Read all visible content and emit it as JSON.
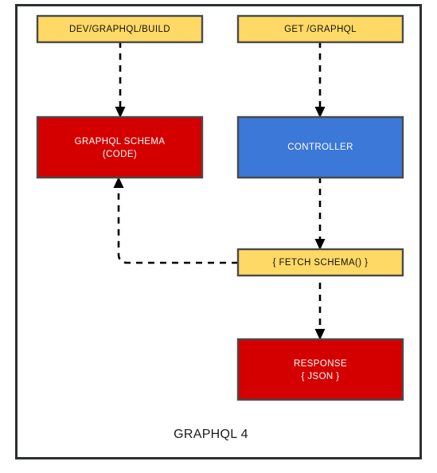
{
  "diagram": {
    "caption": "GRAPHQL 4",
    "frame": {
      "stroke_color": "#2d3033"
    },
    "colors": {
      "yellow_fill": "#FFD966",
      "red_fill": "#D40000",
      "blue_fill": "#3B78D8",
      "box_stroke": "#4a4a4a",
      "arrow_color": "#000000",
      "label_dark": "#111111",
      "label_light": "#ffffff"
    },
    "nodes": [
      {
        "id": "dev-graphql-build",
        "label": "DEV/GRAPHQL/BUILD",
        "fill": "#FFD966",
        "text_color": "dark"
      },
      {
        "id": "get-graphql",
        "label": "GET /GRAPHQL",
        "fill": "#FFD966",
        "text_color": "dark"
      },
      {
        "id": "graphql-schema",
        "label_line1": "GRAPHQL SCHEMA",
        "label_line2": "(CODE)",
        "fill": "#D40000",
        "text_color": "light"
      },
      {
        "id": "controller",
        "label": "CONTROLLER",
        "fill": "#3B78D8",
        "text_color": "light"
      },
      {
        "id": "fetch-schema",
        "label": "{  FETCH SCHEMA()  }",
        "fill": "#FFD966",
        "text_color": "dark"
      },
      {
        "id": "response",
        "label_line1": "RESPONSE",
        "label_line2": "{ JSON }",
        "fill": "#D40000",
        "text_color": "light"
      }
    ],
    "edges": [
      {
        "id": "build-to-schema",
        "from": "dev-graphql-build",
        "to": "graphql-schema",
        "style": "dashed"
      },
      {
        "id": "get-to-controller",
        "from": "get-graphql",
        "to": "controller",
        "style": "dashed"
      },
      {
        "id": "controller-to-fetch",
        "from": "controller",
        "to": "fetch-schema",
        "style": "dashed"
      },
      {
        "id": "fetch-to-schema",
        "from": "fetch-schema",
        "to": "graphql-schema",
        "style": "dashed"
      },
      {
        "id": "fetch-to-response",
        "from": "fetch-schema",
        "to": "response",
        "style": "dashed"
      }
    ]
  }
}
